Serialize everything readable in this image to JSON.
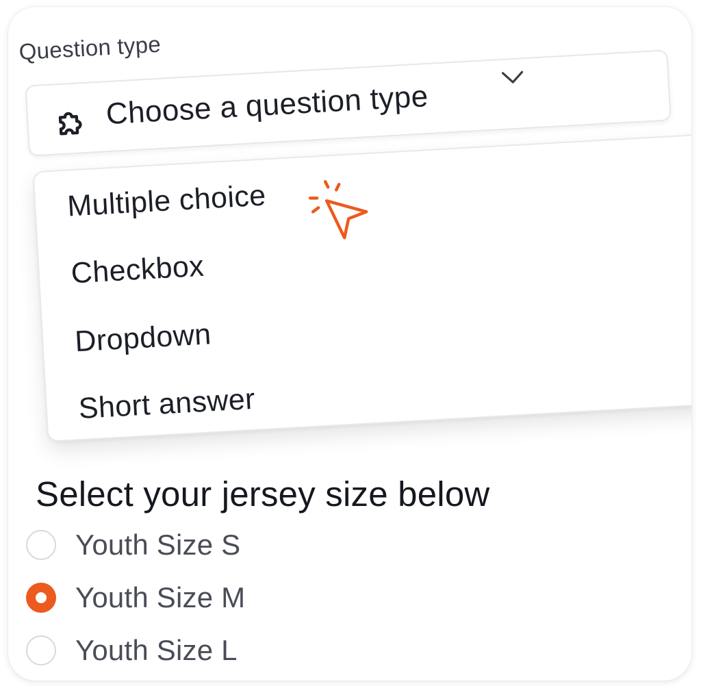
{
  "question_type": {
    "label": "Question type",
    "placeholder": "Choose a question type",
    "options": [
      "Multiple choice",
      "Checkbox",
      "Dropdown",
      "Short answer"
    ]
  },
  "question": {
    "title": "Select your jersey size below",
    "choices": [
      "Youth Size S",
      "Youth Size M",
      "Youth Size L"
    ],
    "selected": "Youth Size M"
  },
  "colors": {
    "accent": "#ec5a1e",
    "radio_border": "#d6d8dc",
    "text_primary": "#1c1f27",
    "text_secondary": "#4a4d57"
  },
  "icons": {
    "select_leading": "puzzle-icon",
    "select_trailing": "chevron-down-icon",
    "pointer": "click-cursor-icon"
  }
}
